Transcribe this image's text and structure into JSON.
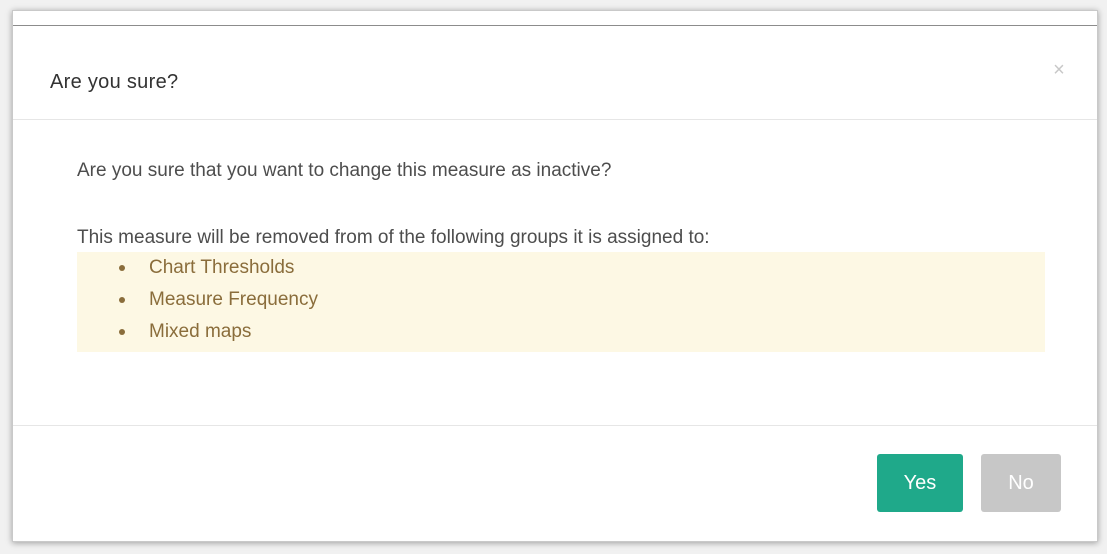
{
  "dialog": {
    "title": "Are you sure?",
    "close_symbol": "×",
    "question": "Are you sure that you want to change this measure as inactive?",
    "removal_text": "This measure will be removed from of the following groups it is assigned to:",
    "groups": [
      "Chart Thresholds",
      "Measure Frequency",
      "Mixed maps"
    ],
    "buttons": {
      "yes_label": "Yes",
      "no_label": "No"
    }
  },
  "colors": {
    "yes_button": "#1fa98a",
    "no_button": "#c7c7c7",
    "warning_background": "#fdf8e4",
    "warning_text": "#8a6d3b"
  },
  "icons": {
    "close": "close-icon",
    "bullet": "bullet-icon"
  }
}
